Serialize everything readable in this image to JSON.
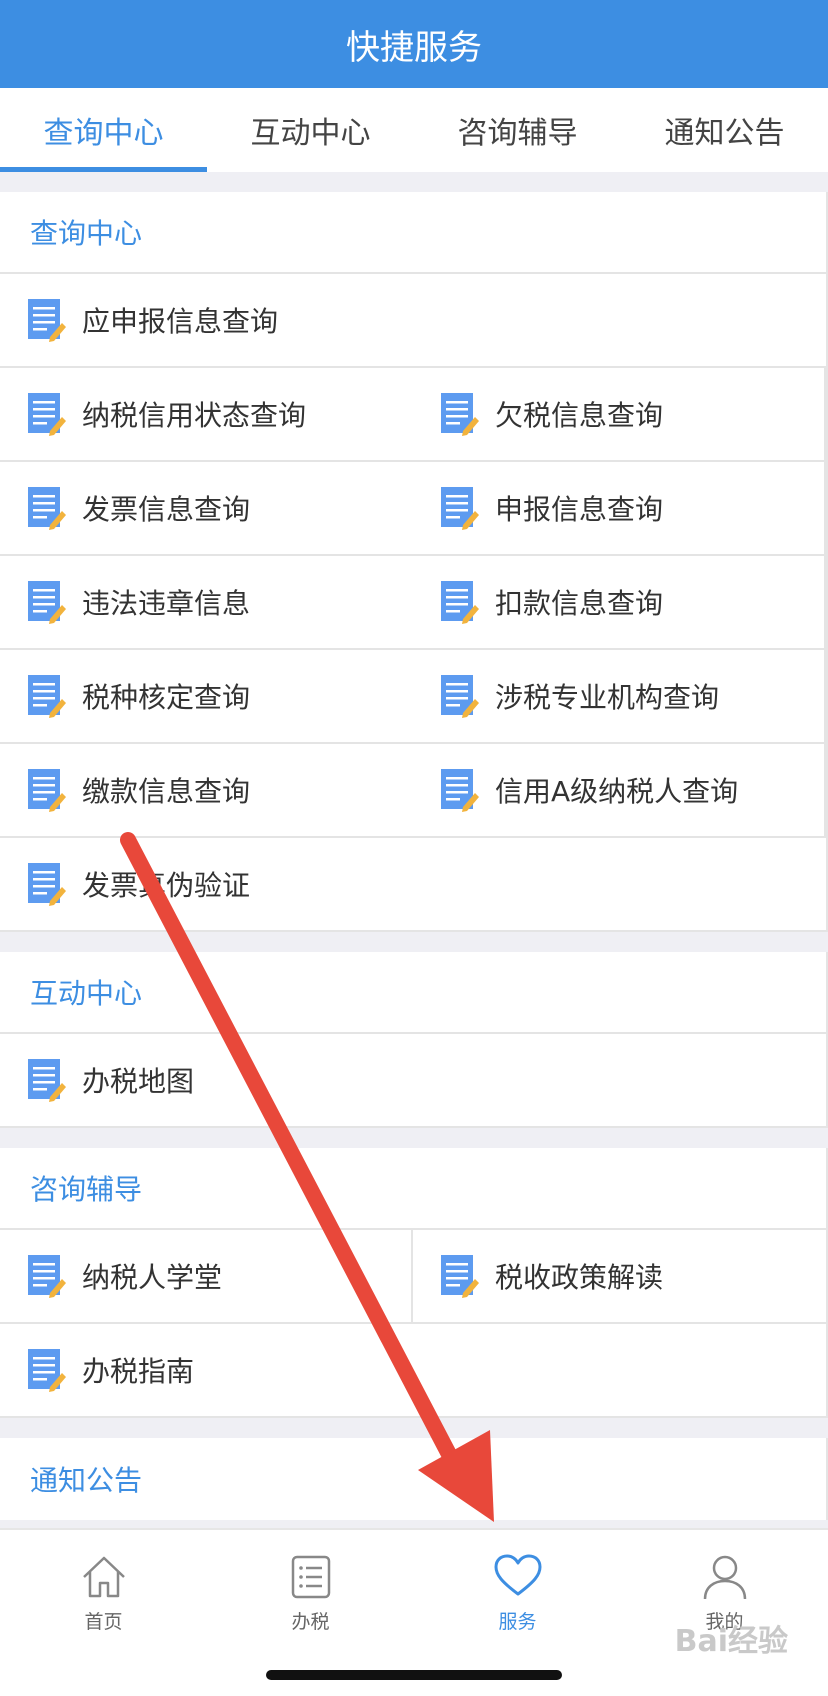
{
  "header": {
    "title": "快捷服务"
  },
  "tabs": [
    {
      "label": "查询中心",
      "active": true
    },
    {
      "label": "互动中心",
      "active": false
    },
    {
      "label": "咨询辅导",
      "active": false
    },
    {
      "label": "通知公告",
      "active": false
    }
  ],
  "sections": {
    "query": {
      "title": "查询中心",
      "items": [
        "应申报信息查询",
        "纳税信用状态查询",
        "欠税信息查询",
        "发票信息查询",
        "申报信息查询",
        "违法违章信息",
        "扣款信息查询",
        "税种核定查询",
        "涉税专业机构查询",
        "缴款信息查询",
        "信用A级纳税人查询",
        "发票真伪验证"
      ]
    },
    "interaction": {
      "title": "互动中心",
      "items": [
        "办税地图"
      ]
    },
    "consult": {
      "title": "咨询辅导",
      "items": [
        "纳税人学堂",
        "税收政策解读",
        "办税指南"
      ]
    },
    "notice": {
      "title": "通知公告"
    }
  },
  "tabbar": [
    {
      "label": "首页",
      "icon": "home-icon"
    },
    {
      "label": "办税",
      "icon": "list-icon"
    },
    {
      "label": "服务",
      "icon": "heart-icon",
      "active": true
    },
    {
      "label": "我的",
      "icon": "user-icon"
    }
  ],
  "watermark": "Bai经验",
  "colors": {
    "accent": "#3d8ee2",
    "arrow": "#e8483a"
  }
}
